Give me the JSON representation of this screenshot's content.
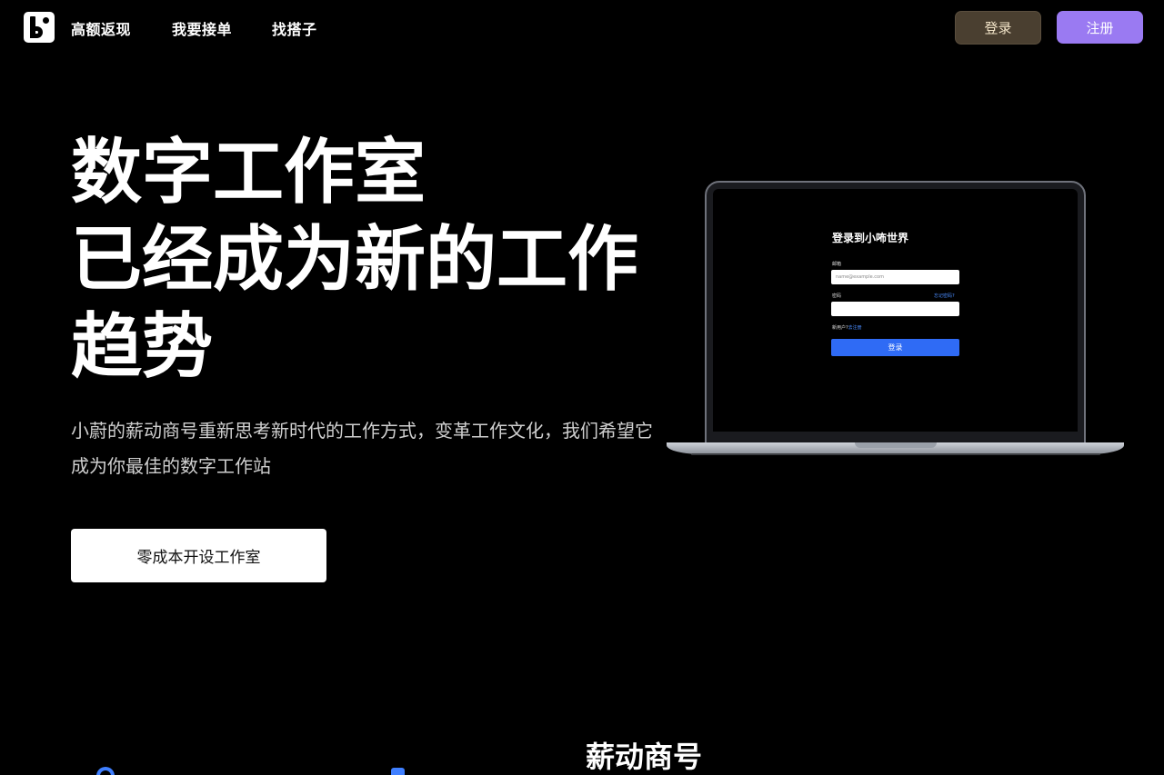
{
  "nav": {
    "links": [
      "高额返现",
      "我要接单",
      "找搭子"
    ],
    "login_label": "登录",
    "register_label": "注册"
  },
  "hero": {
    "title_lines": [
      "数字工作室",
      "已经成为新的工作",
      "趋势"
    ],
    "description": "小蔚的薪动商号重新思考新时代的工作方式，变革工作文化，我们希望它成为你最佳的数字工作站",
    "cta_label": "零成本开设工作室"
  },
  "laptop_login": {
    "title": "登录到小咘世界",
    "email_label": "邮箱",
    "email_placeholder": "name@example.com",
    "password_label": "密码",
    "forgot_label": "忘记密码?",
    "new_user_prompt": "新用户?",
    "signup_link": "去注册",
    "submit_label": "登录"
  },
  "section": {
    "title": "薪动商号"
  },
  "colors": {
    "background": "#000000",
    "login_button": "#4a3f30",
    "register_button": "#9a7af2",
    "accent_blue": "#2f6bf5"
  }
}
